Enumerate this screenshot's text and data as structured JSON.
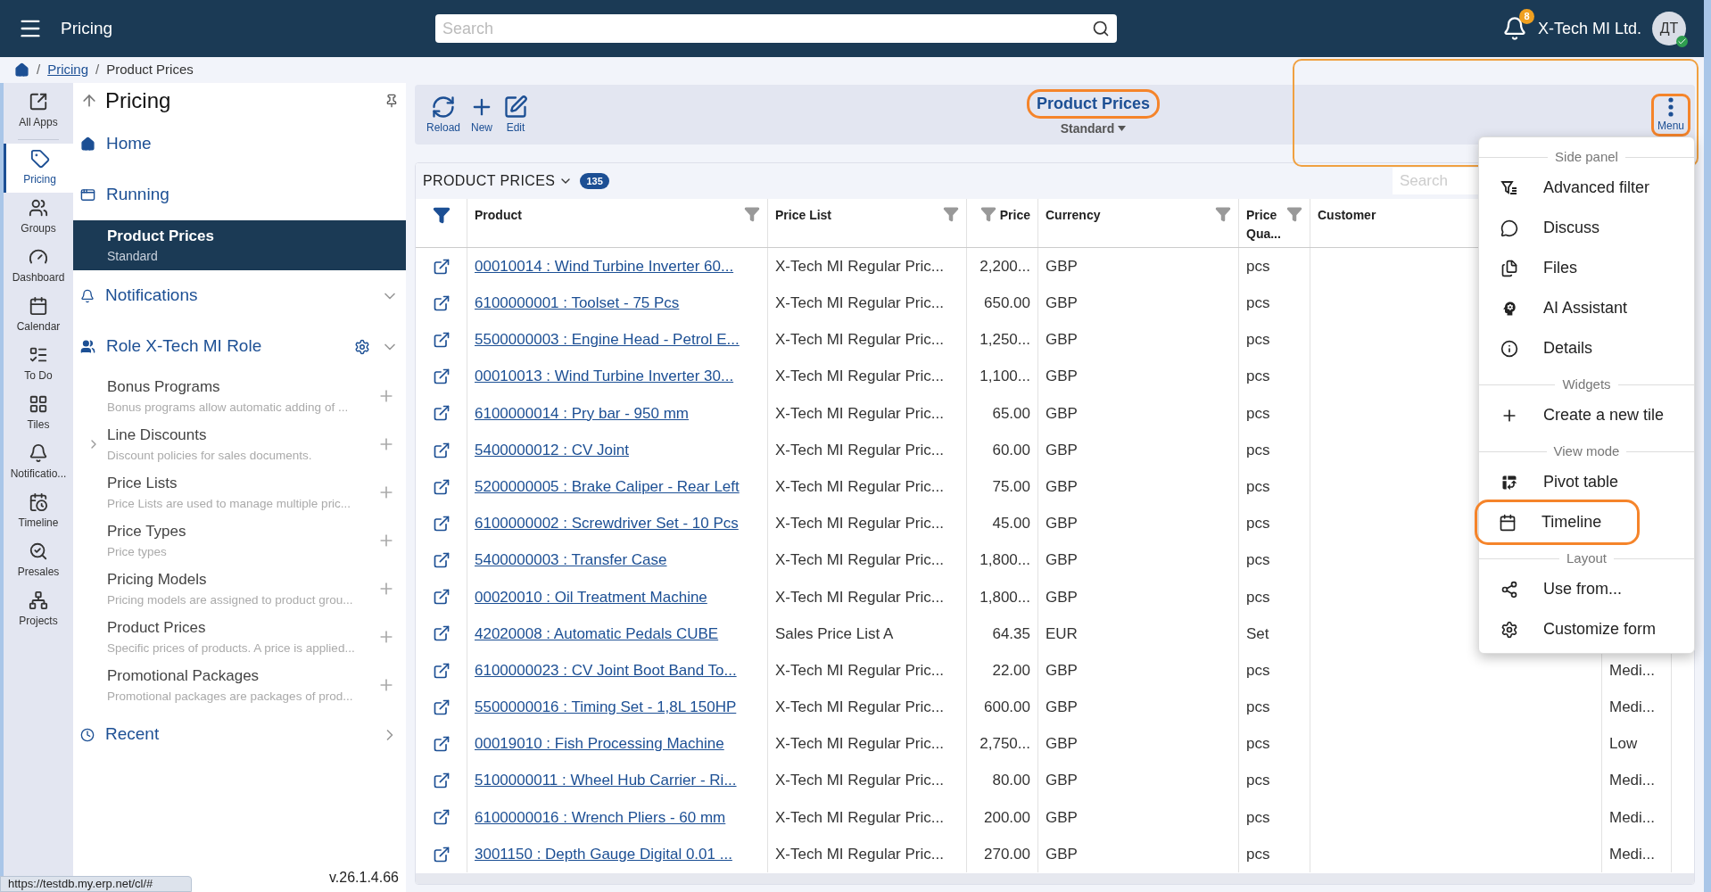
{
  "top_bar": {
    "title": "Pricing",
    "search": {
      "placeholder": "Search"
    },
    "notification_count": "8",
    "company": "X-Tech MI Ltd.",
    "avatar": "ДТ"
  },
  "breadcrumb": [
    {
      "separator": "/",
      "label": "Pricing",
      "link": true
    },
    {
      "separator": "/",
      "label": "Product Prices",
      "link": false
    }
  ],
  "rail": [
    {
      "label": "All Apps",
      "selected": false
    },
    {
      "label": "Pricing",
      "selected": true
    },
    {
      "label": "Groups",
      "selected": false
    },
    {
      "label": "Dashboard",
      "selected": false
    },
    {
      "label": "Calendar",
      "selected": false
    },
    {
      "label": "To Do",
      "selected": false
    },
    {
      "label": "Tiles",
      "selected": false
    },
    {
      "label": "Notificatio...",
      "selected": false
    },
    {
      "label": "Timeline",
      "selected": false
    },
    {
      "label": "Presales",
      "selected": false
    },
    {
      "label": "Projects",
      "selected": false
    }
  ],
  "nav": {
    "title": "Pricing",
    "items": [
      {
        "kind": "link",
        "label": "Home"
      },
      {
        "kind": "link",
        "label": "Running"
      },
      {
        "kind": "current",
        "label": "Product Prices",
        "subtitle": "Standard"
      },
      {
        "kind": "section",
        "label": "Notifications"
      },
      {
        "kind": "role",
        "label": "Role X-Tech MI Role"
      }
    ],
    "role_items": [
      {
        "title": "Bonus Programs",
        "description": "Bonus programs allow automatic adding of ...",
        "expandable": false
      },
      {
        "title": "Line Discounts",
        "description": "Discount policies for sales documents.",
        "expandable": true
      },
      {
        "title": "Price Lists",
        "description": "Price Lists are used to manage multiple pric...",
        "expandable": false
      },
      {
        "title": "Price Types",
        "description": "Price types",
        "expandable": false
      },
      {
        "title": "Pricing Models",
        "description": "Pricing models are assigned to product grou...",
        "expandable": false
      },
      {
        "title": "Product Prices",
        "description": "Specific prices of products. A price is applied...",
        "expandable": false
      },
      {
        "title": "Promotional Packages",
        "description": "Promotional packages are packages of prod...",
        "expandable": false
      }
    ],
    "recent": "Recent",
    "version": "v.26.1.4.66"
  },
  "status_url": "https://testdb.my.erp.net/cl/#",
  "toolbar": {
    "buttons": [
      "Reload",
      "New",
      "Edit"
    ],
    "title": "Product Prices",
    "title_highlighted": true,
    "view": "Standard",
    "menu": "Menu",
    "menu_highlighted": true
  },
  "table": {
    "title": "PRODUCT PRICES",
    "count": "135",
    "search": {
      "placeholder": "Search"
    },
    "columns": [
      {
        "label": "Product",
        "filter": true,
        "numeric": false
      },
      {
        "label": "Price List",
        "filter": true,
        "numeric": false
      },
      {
        "label": "Price",
        "filter": true,
        "numeric": true
      },
      {
        "label": "Currency",
        "filter": true,
        "numeric": false
      },
      {
        "label": "Price Qua...",
        "filter": true,
        "numeric": false
      },
      {
        "label": "Customer",
        "filter": false,
        "numeric": false
      }
    ],
    "rows": [
      {
        "product": "00010014 : Wind Turbine Inverter 60...",
        "price_list": "X-Tech MI Regular Pric...",
        "price": "2,200...",
        "currency": "GBP",
        "unit": "pcs"
      },
      {
        "product": "6100000001 : Toolset - 75 Pcs",
        "price_list": "X-Tech MI Regular Pric...",
        "price": "650.00",
        "currency": "GBP",
        "unit": "pcs"
      },
      {
        "product": "5500000003 : Engine Head - Petrol E...",
        "price_list": "X-Tech MI Regular Pric...",
        "price": "1,250...",
        "currency": "GBP",
        "unit": "pcs"
      },
      {
        "product": "00010013 : Wind Turbine Inverter 30...",
        "price_list": "X-Tech MI Regular Pric...",
        "price": "1,100...",
        "currency": "GBP",
        "unit": "pcs"
      },
      {
        "product": "6100000014 : Pry bar - 950 mm",
        "price_list": "X-Tech MI Regular Pric...",
        "price": "65.00",
        "currency": "GBP",
        "unit": "pcs"
      },
      {
        "product": "5400000012 : CV Joint",
        "price_list": "X-Tech MI Regular Pric...",
        "price": "60.00",
        "currency": "GBP",
        "unit": "pcs"
      },
      {
        "product": "5200000005 : Brake Caliper - Rear Left",
        "price_list": "X-Tech MI Regular Pric...",
        "price": "75.00",
        "currency": "GBP",
        "unit": "pcs"
      },
      {
        "product": "6100000002 : Screwdriver Set - 10 Pcs",
        "price_list": "X-Tech MI Regular Pric...",
        "price": "45.00",
        "currency": "GBP",
        "unit": "pcs"
      },
      {
        "product": "5400000003 : Transfer Case",
        "price_list": "X-Tech MI Regular Pric...",
        "price": "1,800...",
        "currency": "GBP",
        "unit": "pcs"
      },
      {
        "product": "00020010 : Oil Treatment Machine",
        "price_list": "X-Tech MI Regular Pric...",
        "price": "1,800...",
        "currency": "GBP",
        "unit": "pcs"
      },
      {
        "product": "42020008 : Automatic Pedals CUBE",
        "price_list": "Sales Price List A",
        "price": "64.35",
        "currency": "EUR",
        "unit": "Set"
      },
      {
        "product": "6100000023 : CV Joint Boot Band To...",
        "price_list": "X-Tech MI Regular Pric...",
        "price": "22.00",
        "currency": "GBP",
        "unit": "pcs",
        "column_8": "Medi..."
      },
      {
        "product": "5500000016 : Timing Set - 1,8L 150HP",
        "price_list": "X-Tech MI Regular Pric...",
        "price": "600.00",
        "currency": "GBP",
        "unit": "pcs",
        "column_8": "Medi..."
      },
      {
        "product": "00019010 : Fish Processing Machine",
        "price_list": "X-Tech MI Regular Pric...",
        "price": "2,750...",
        "currency": "GBP",
        "unit": "pcs",
        "column_8": "Low"
      },
      {
        "product": "5100000011 : Wheel Hub Carrier - Ri...",
        "price_list": "X-Tech MI Regular Pric...",
        "price": "80.00",
        "currency": "GBP",
        "unit": "pcs",
        "column_8": "Medi..."
      },
      {
        "product": "6100000016 : Wrench Pliers - 60 mm",
        "price_list": "X-Tech MI Regular Pric...",
        "price": "200.00",
        "currency": "GBP",
        "unit": "pcs",
        "column_8": "Medi..."
      },
      {
        "product": "3001150 : Depth Gauge Digital 0.01 ...",
        "price_list": "X-Tech MI Regular Pric...",
        "price": "270.00",
        "currency": "GBP",
        "unit": "pcs",
        "column_8": "Medi..."
      }
    ]
  },
  "menu": [
    {
      "kind": "header",
      "label": "Side panel"
    },
    {
      "kind": "item",
      "label": "Advanced filter",
      "highlighted": false
    },
    {
      "kind": "item",
      "label": "Discuss",
      "highlighted": false
    },
    {
      "kind": "item",
      "label": "Files",
      "highlighted": false
    },
    {
      "kind": "item",
      "label": "AI Assistant",
      "highlighted": false
    },
    {
      "kind": "item",
      "label": "Details",
      "highlighted": false
    },
    {
      "kind": "header",
      "label": "Widgets"
    },
    {
      "kind": "item",
      "label": "Create a new tile",
      "highlighted": false
    },
    {
      "kind": "header",
      "label": "View mode"
    },
    {
      "kind": "item",
      "label": "Pivot table",
      "highlighted": false
    },
    {
      "kind": "item",
      "label": "Timeline",
      "highlighted": true
    },
    {
      "kind": "header",
      "label": "Layout"
    },
    {
      "kind": "item",
      "label": "Use from...",
      "highlighted": false
    },
    {
      "kind": "item",
      "label": "Customize form",
      "highlighted": false
    }
  ]
}
